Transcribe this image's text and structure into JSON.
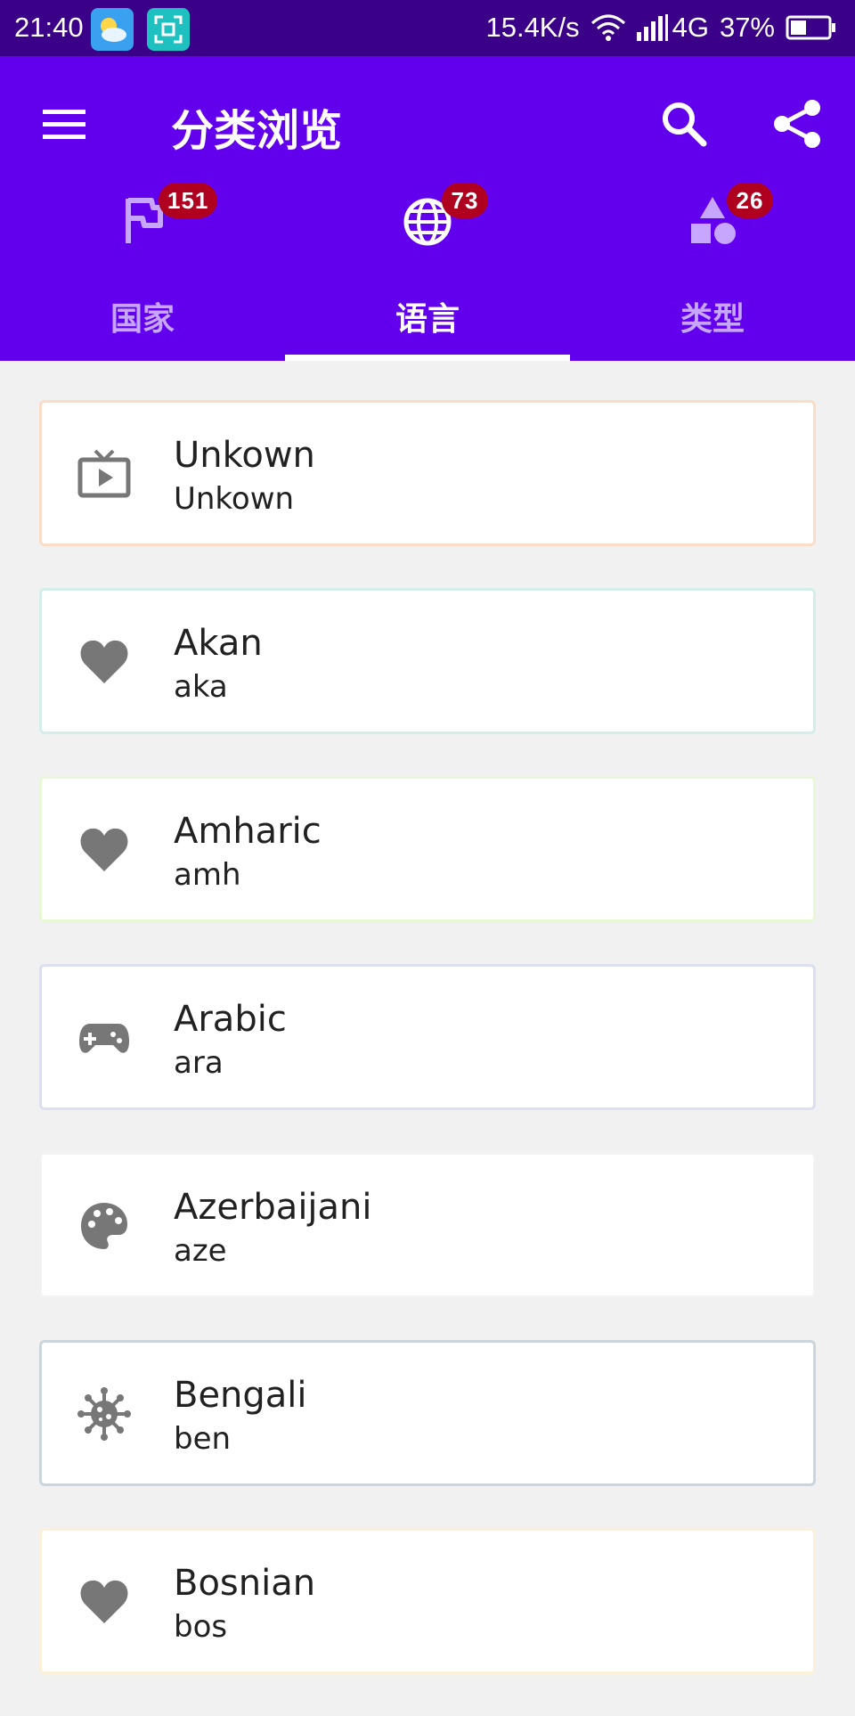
{
  "status_bar": {
    "time": "21:40",
    "network_speed": "15.4K/s",
    "network_type": "4G",
    "battery": "37%",
    "icons": [
      "weather-app-icon",
      "screenshot-app-icon",
      "wifi-icon",
      "signal-icon",
      "battery-icon"
    ]
  },
  "app_bar": {
    "title": "分类浏览",
    "menu_icon": "menu-icon",
    "search_icon": "search-icon",
    "share_icon": "share-icon",
    "background_color": "#6200ee"
  },
  "tabs": [
    {
      "label": "国家",
      "badge": "151",
      "icon": "flag-icon",
      "active": false
    },
    {
      "label": "语言",
      "badge": "73",
      "icon": "globe-icon",
      "active": true
    },
    {
      "label": "类型",
      "badge": "26",
      "icon": "shapes-icon",
      "active": false
    }
  ],
  "languages": [
    {
      "name": "Unkown",
      "code": "Unkown",
      "icon": "tv-icon",
      "border_color": "#fbdcc6"
    },
    {
      "name": "Akan",
      "code": "aka",
      "icon": "heart-icon",
      "border_color": "#d3eeea"
    },
    {
      "name": "Amharic",
      "code": "amh",
      "icon": "heart-icon",
      "border_color": "#e8f7d6"
    },
    {
      "name": "Arabic",
      "code": "ara",
      "icon": "gamepad-icon",
      "border_color": "#dcdff0"
    },
    {
      "name": "Azerbaijani",
      "code": "aze",
      "icon": "palette-icon",
      "border_color": "#f3f3f3"
    },
    {
      "name": "Bengali",
      "code": "ben",
      "icon": "virus-icon",
      "border_color": "#cbd5dd"
    },
    {
      "name": "Bosnian",
      "code": "bos",
      "icon": "heart-icon",
      "border_color": "#fbf1d8"
    }
  ]
}
